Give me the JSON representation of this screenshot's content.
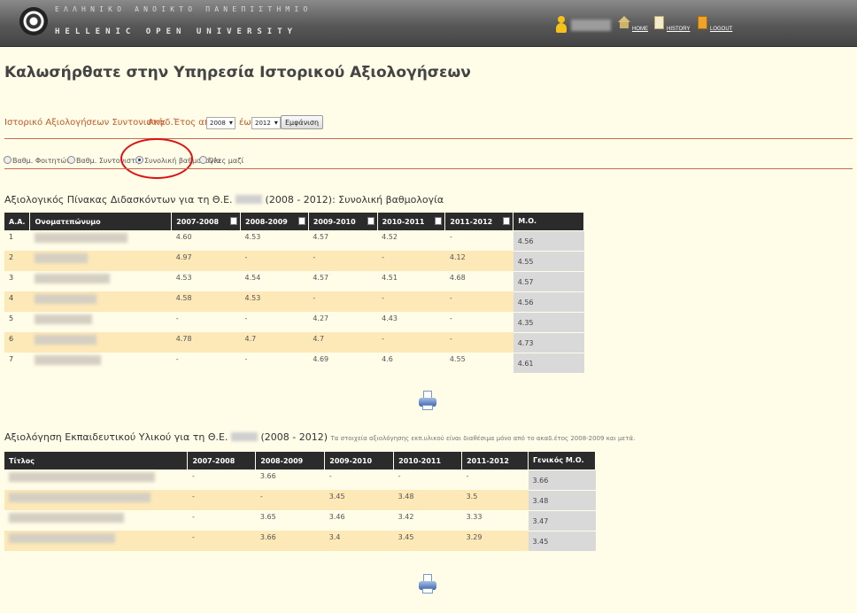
{
  "header": {
    "university_gr": "ΕΛΛΗΝΙΚΟ ΑΝΟΙΚΤΟ ΠΑΝΕΠΙΣΤΗΜΙΟ",
    "university_en": "HELLENIC OPEN UNIVERSITY",
    "nav": {
      "home": "HOME",
      "history": "HISTORY",
      "logout": "LOGOUT"
    }
  },
  "page_title": "Καλωσήρθατε στην Υπηρεσία Ιστορικού Αξιολογήσεων",
  "filter": {
    "label": "Ιστορικό Αξιολογήσεων Συντονιστή:",
    "year_from_label": "Ακαδ.Έτος από",
    "year_from": "2008",
    "year_to_label": "έως",
    "year_to": "2012",
    "show_button": "Εμφάνιση"
  },
  "view_options": [
    {
      "label": "Βαθμ. Φοιτητών",
      "selected": false
    },
    {
      "label": "Βαθμ. Συντονιστή",
      "selected": false
    },
    {
      "label": "Συνολική βαθμολογία",
      "selected": true
    },
    {
      "label": "Όλες μαζί",
      "selected": false
    }
  ],
  "tutors_table": {
    "title_prefix": "Αξιολογικός Πίνακας Διδασκόντων για τη Θ.Ε.",
    "title_suffix": "(2008 - 2012): Συνολική βαθμολογία",
    "headers": [
      "Α.Α.",
      "Ονοματεπώνυμο",
      "2007-2008",
      "2008-2009",
      "2009-2010",
      "2010-2011",
      "2011-2012",
      "Μ.Ο."
    ],
    "rows": [
      {
        "aa": "1",
        "values": [
          "4.60",
          "4.53",
          "4.57",
          "4.52",
          "-"
        ],
        "avg": "4.56"
      },
      {
        "aa": "2",
        "values": [
          "4.97",
          "-",
          "-",
          "-",
          "4.12"
        ],
        "avg": "4.55"
      },
      {
        "aa": "3",
        "values": [
          "4.53",
          "4.54",
          "4.57",
          "4.51",
          "4.68"
        ],
        "avg": "4.57"
      },
      {
        "aa": "4",
        "values": [
          "4.58",
          "4.53",
          "-",
          "-",
          "-"
        ],
        "avg": "4.56"
      },
      {
        "aa": "5",
        "values": [
          "-",
          "-",
          "4.27",
          "4.43",
          "-"
        ],
        "avg": "4.35"
      },
      {
        "aa": "6",
        "values": [
          "4.78",
          "4.7",
          "4.7",
          "-",
          "-"
        ],
        "avg": "4.73"
      },
      {
        "aa": "7",
        "values": [
          "-",
          "-",
          "4.69",
          "4.6",
          "4.55"
        ],
        "avg": "4.61"
      }
    ]
  },
  "material_table": {
    "title_prefix": "Αξιολόγηση Εκπαιδευτικού Υλικού για τη Θ.Ε.",
    "title_suffix": "(2008 - 2012)",
    "note": "Τα στοιχεία αξιολόγησης εκπ.υλικού είναι διαθέσιμα μόνο από το ακαδ.έτος 2008-2009 και μετά.",
    "headers": [
      "Τίτλος",
      "2007-2008",
      "2008-2009",
      "2009-2010",
      "2010-2011",
      "2011-2012",
      "Γενικός Μ.Ο."
    ],
    "rows": [
      {
        "values": [
          "-",
          "3.66",
          "-",
          "-",
          "-"
        ],
        "avg": "3.66"
      },
      {
        "values": [
          "-",
          "-",
          "3.45",
          "3.48",
          "3.5"
        ],
        "avg": "3.48"
      },
      {
        "values": [
          "-",
          "3.65",
          "3.46",
          "3.42",
          "3.33"
        ],
        "avg": "3.47"
      },
      {
        "values": [
          "-",
          "3.66",
          "3.4",
          "3.45",
          "3.29"
        ],
        "avg": "3.45"
      }
    ]
  },
  "colors": {
    "background": "#fffce8",
    "header_row": "#2b2b2b",
    "alt_row": "#fde8b8",
    "avg_cell": "#d9d9d9",
    "filter_text": "#c35a2b"
  },
  "icons": [
    "user-icon",
    "home-icon",
    "history-icon",
    "logout-icon",
    "copy-icon",
    "printer-icon"
  ]
}
